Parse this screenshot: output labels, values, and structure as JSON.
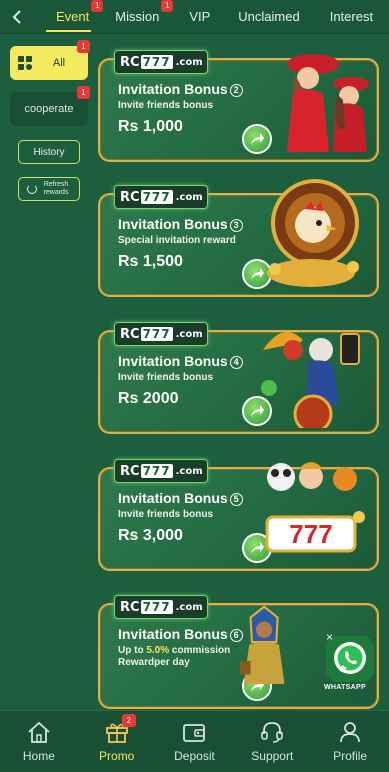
{
  "topnav": {
    "back_icon": "chevron-left-icon",
    "tabs": [
      {
        "label": "Event",
        "badge": "1",
        "active": true
      },
      {
        "label": "Mission",
        "badge": "1",
        "active": false
      },
      {
        "label": "VIP",
        "badge": "",
        "active": false
      },
      {
        "label": "Unclaimed",
        "badge": "",
        "active": false
      },
      {
        "label": "Interest",
        "badge": "",
        "active": false
      }
    ]
  },
  "sidebar": {
    "all_label": "All",
    "all_badge": "1",
    "cooperate_label": "cooperate",
    "cooperate_badge": "1",
    "history_label": "History",
    "refresh_label": "Refresh rewards"
  },
  "banners": [
    {
      "logo_prefix": "RC",
      "logo_digits": "777",
      "logo_domain": ".com",
      "title": "Invitation Bonus",
      "num": "2",
      "subtitle": "Invite friends bonus",
      "subtitle_highlight": "",
      "subtitle2": "",
      "amount": "Rs 1,000"
    },
    {
      "logo_prefix": "RC",
      "logo_digits": "777",
      "logo_domain": ".com",
      "title": "Invitation Bonus",
      "num": "3",
      "subtitle": "Special invitation reward",
      "subtitle_highlight": "",
      "subtitle2": "",
      "amount": "Rs 1,500"
    },
    {
      "logo_prefix": "RC",
      "logo_digits": "777",
      "logo_domain": ".com",
      "title": "Invitation Bonus",
      "num": "4",
      "subtitle": "Invite friends bonus",
      "subtitle_highlight": "",
      "subtitle2": "",
      "amount": "Rs 2000"
    },
    {
      "logo_prefix": "RC",
      "logo_digits": "777",
      "logo_domain": ".com",
      "title": "Invitation Bonus",
      "num": "5",
      "subtitle": "Invite friends bonus",
      "subtitle_highlight": "",
      "subtitle2": "",
      "amount": "Rs 3,000"
    },
    {
      "logo_prefix": "RC",
      "logo_digits": "777",
      "logo_domain": ".com",
      "title": "Invitation Bonus",
      "num": "6",
      "subtitle": "Up to ",
      "subtitle_highlight": "5.0%",
      "subtitle_rest": " commission",
      "subtitle2": "Rewardper day",
      "amount": ""
    }
  ],
  "whatsapp": {
    "label": "WHATSAPP",
    "close": "×"
  },
  "bottomnav": {
    "items": [
      {
        "label": "Home",
        "icon": "home-icon"
      },
      {
        "label": "Promo",
        "icon": "gift-icon",
        "badge": "2"
      },
      {
        "label": "Deposit",
        "icon": "wallet-icon"
      },
      {
        "label": "Support",
        "icon": "headset-icon"
      },
      {
        "label": "Profile",
        "icon": "profile-icon"
      }
    ]
  },
  "colors": {
    "background": "#1d5e3e",
    "accent": "#f4e85a",
    "badge": "#e53935",
    "banner_border": "#d8b34c"
  }
}
